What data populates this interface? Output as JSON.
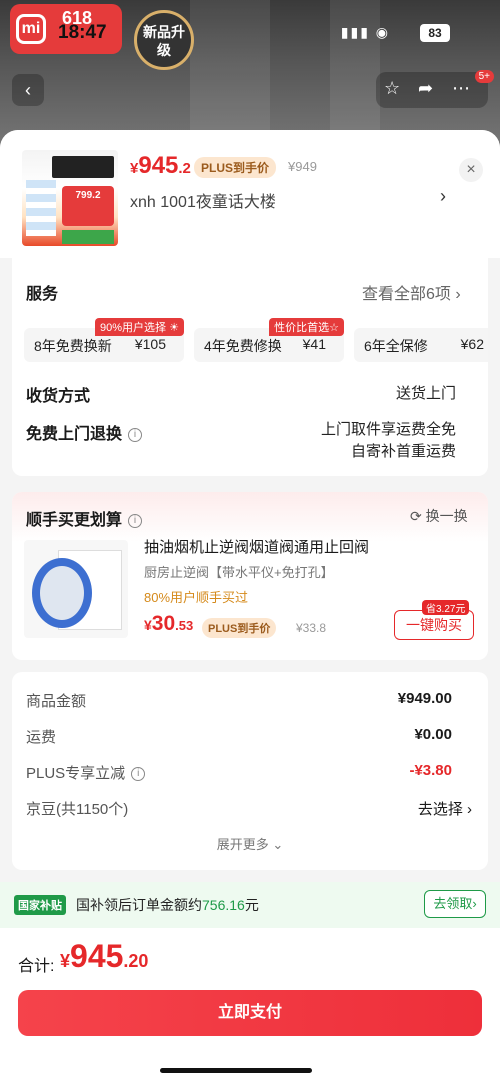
{
  "status_bar": {
    "time": "18:47",
    "battery": "83"
  },
  "promo": {
    "logo_text": "mi",
    "event": "618",
    "new_badge": "新品升级"
  },
  "product": {
    "price_symbol": "¥",
    "price_int": "945",
    "price_dec": ".2",
    "plus_tag": "PLUS到手价",
    "orig_price": "¥949",
    "address": "xnh  1001夜童话大楼",
    "thumb_price": "799.2"
  },
  "service": {
    "title": "服务",
    "link": "查看全部6项",
    "items": [
      {
        "name": "8年免费换新",
        "price": "¥105",
        "badge": "90%用户选择"
      },
      {
        "name": "4年免费修换",
        "price": "¥41",
        "badge": "性价比首选"
      },
      {
        "name": "6年全保修",
        "price": "¥62",
        "badge": ""
      }
    ],
    "delivery_label": "收货方式",
    "delivery_value": "送货上门",
    "return_label": "免费上门退换",
    "return_value_1": "上门取件享运费全免",
    "return_value_2": "自寄补首重运费"
  },
  "upsell": {
    "title": "顺手买更划算",
    "swap": "换一换",
    "item_title": "抽油烟机止逆阀烟道阀通用止回阀",
    "item_sub": "厨房止逆阀【带水平仪+免打孔】",
    "item_note": "80%用户顺手买过",
    "price_symbol": "¥",
    "price_int": "30",
    "price_dec": ".53",
    "plus_tag": "PLUS到手价",
    "orig_price": "¥33.8",
    "save_tag": "省3.27元",
    "buy_label": "一键购买"
  },
  "summary": {
    "rows": [
      {
        "label": "商品金额",
        "value": "¥949.00"
      },
      {
        "label": "运费",
        "value": "¥0.00"
      },
      {
        "label": "PLUS专享立减",
        "value": "-¥3.80"
      },
      {
        "label": "京豆(共1150个)",
        "value": "去选择"
      }
    ],
    "expand": "展开更多"
  },
  "subsidy": {
    "tag": "国家补贴",
    "text": "国补领后订单金额约",
    "amount": "756.16",
    "unit": "元",
    "button": "去领取"
  },
  "footer": {
    "total_label": "合计:",
    "price_symbol": "¥",
    "price_int": "945",
    "price_dec": ".20",
    "pay_label": "立即支付"
  },
  "colors": {
    "accent": "#e5282a",
    "green": "#1f9a48",
    "plus": "#9b5b1d"
  }
}
